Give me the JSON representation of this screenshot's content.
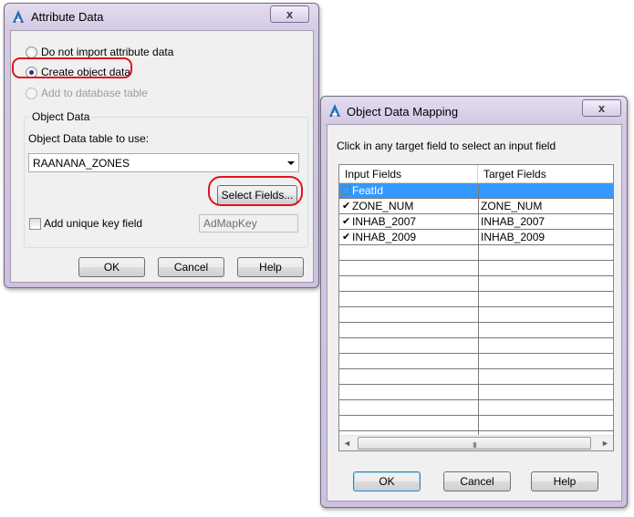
{
  "attribute_dialog": {
    "title": "Attribute Data",
    "close_glyph": "x",
    "options": {
      "do_not_import": "Do not import attribute data",
      "create_object_data": "Create object data",
      "add_to_database": "Add to database table",
      "selected": "create_object_data"
    },
    "object_data_group": {
      "title": "Object Data",
      "table_label": "Object Data table to use:",
      "table_value": "RAANANA_ZONES",
      "select_fields_label": "Select Fields...",
      "unique_key_label": "Add unique key field",
      "unique_key_checked": false,
      "unique_key_value": "AdMapKey"
    },
    "buttons": {
      "ok": "OK",
      "cancel": "Cancel",
      "help": "Help"
    }
  },
  "mapping_dialog": {
    "title": "Object Data Mapping",
    "close_glyph": "x",
    "instruction": "Click in any target field to select an input field",
    "columns": {
      "input": "Input Fields",
      "target": "Target Fields"
    },
    "rows": [
      {
        "input": "FeatId",
        "target": "",
        "checked": false,
        "selected": true
      },
      {
        "input": "ZONE_NUM",
        "target": "ZONE_NUM",
        "checked": true,
        "selected": false
      },
      {
        "input": "INHAB_2007",
        "target": "INHAB_2007",
        "checked": true,
        "selected": false
      },
      {
        "input": "INHAB_2009",
        "target": "INHAB_2009",
        "checked": true,
        "selected": false
      }
    ],
    "checkmark_glyph": "✔",
    "scrollbar": {
      "left_arrow": "◄",
      "right_arrow": "►",
      "thumb_grip": "III"
    },
    "buttons": {
      "ok": "OK",
      "cancel": "Cancel",
      "help": "Help"
    }
  },
  "colors": {
    "annotation_ring": "#e0141e",
    "selection": "#3399ff",
    "window_frame": "#d4c8e4"
  },
  "icons": {
    "app_icon": "autocad-a-icon",
    "close": "close-icon",
    "dropdown": "chevron-down-icon"
  }
}
